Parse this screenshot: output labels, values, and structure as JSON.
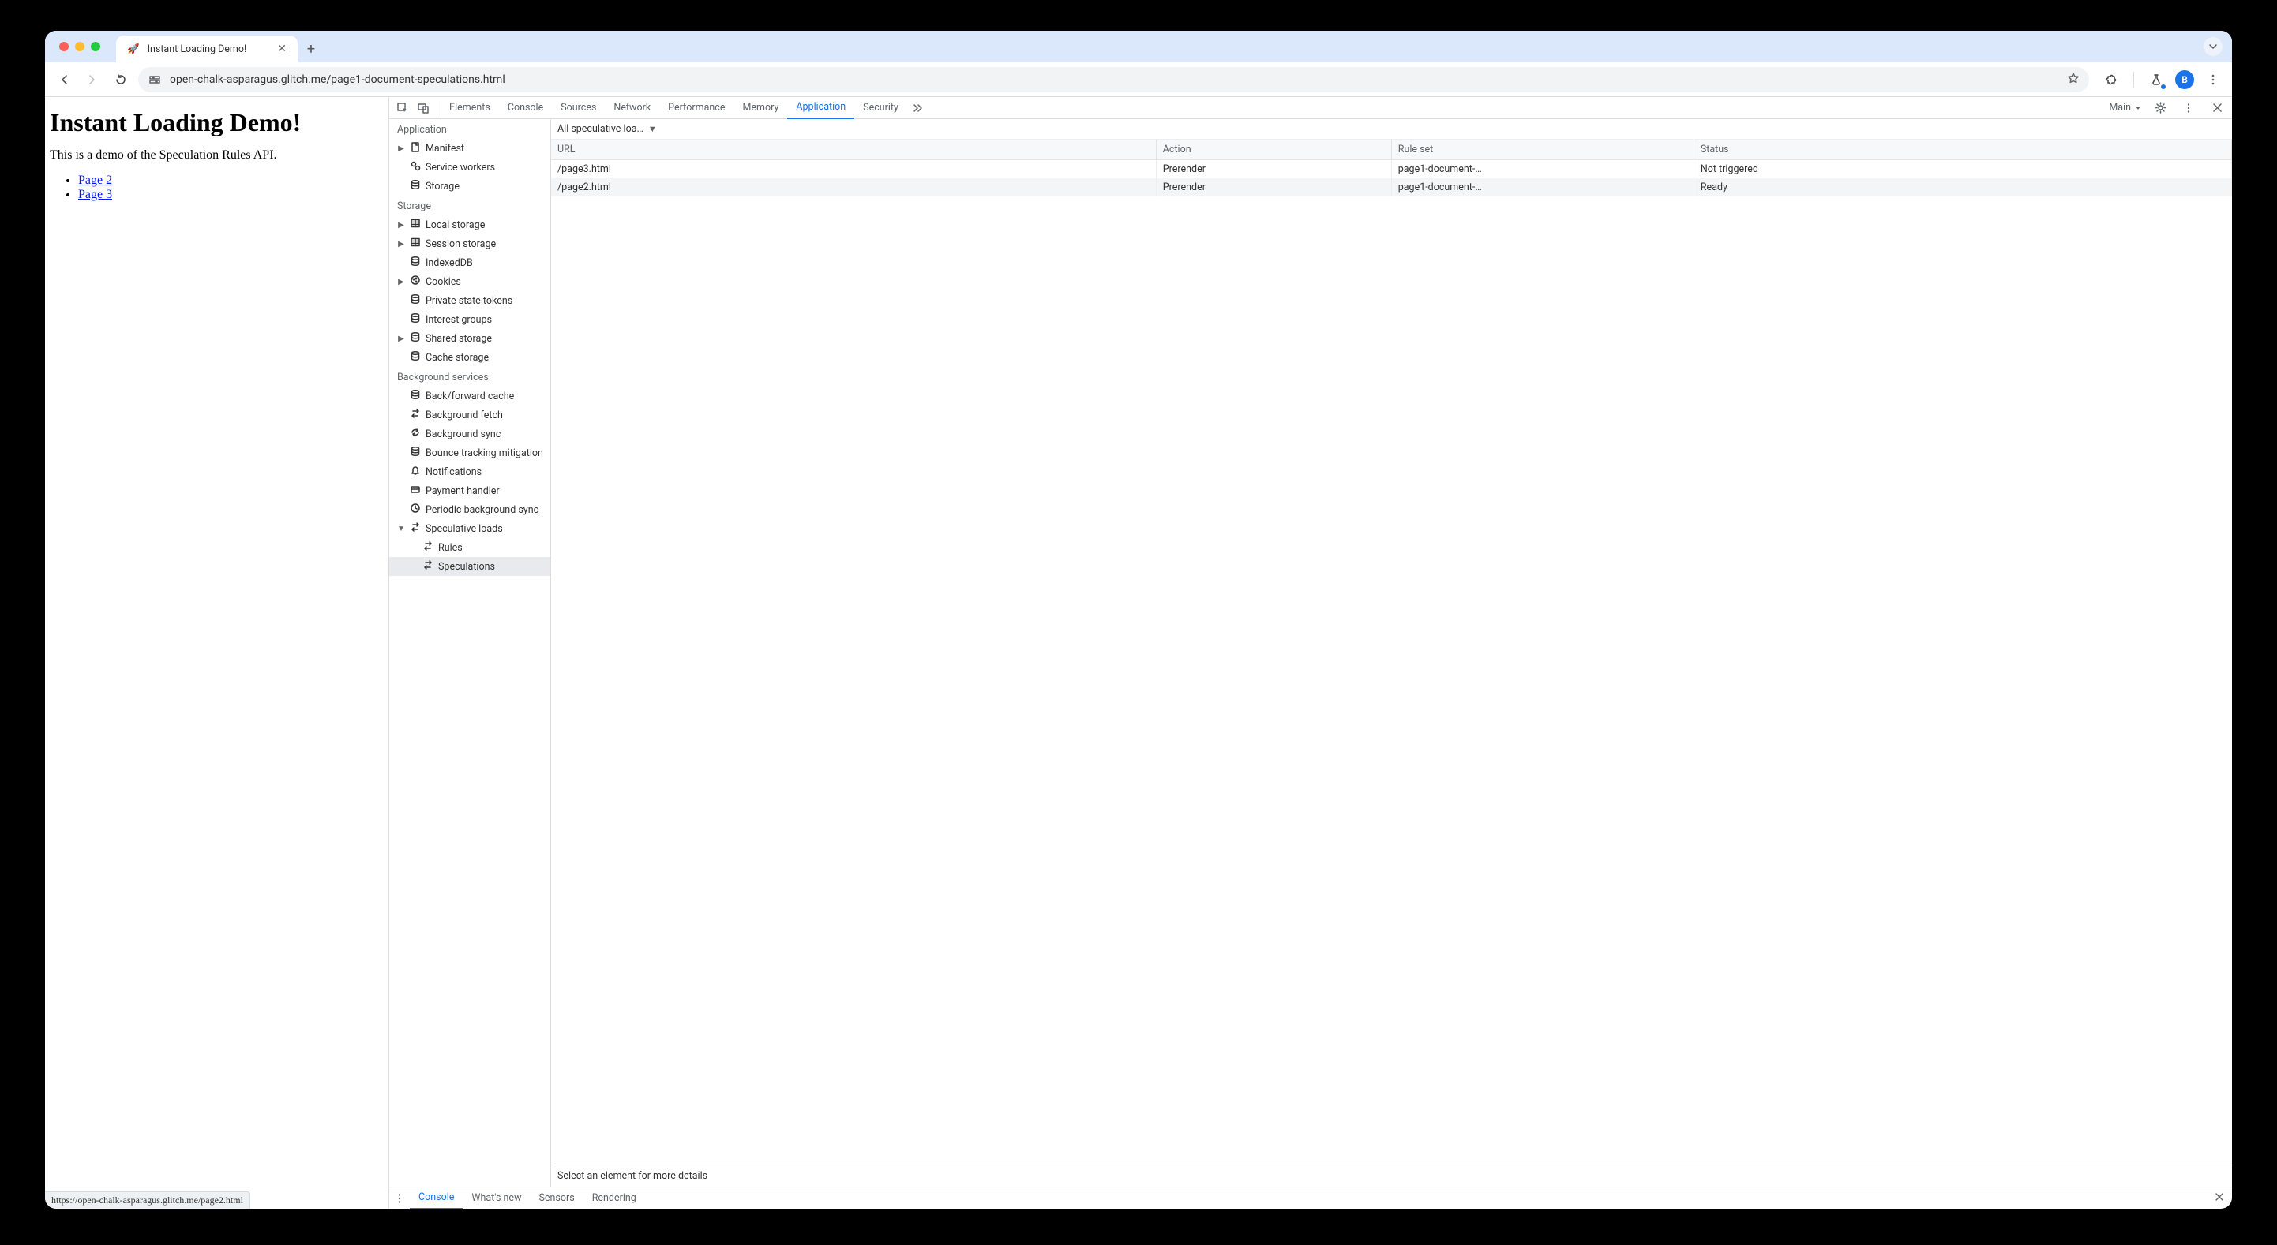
{
  "browser": {
    "tab_title": "Instant Loading Demo!",
    "url": "open-chalk-asparagus.glitch.me/page1-document-speculations.html",
    "avatar_letter": "B",
    "status_hover": "https://open-chalk-asparagus.glitch.me/page2.html"
  },
  "page": {
    "heading": "Instant Loading Demo!",
    "intro": "This is a demo of the Speculation Rules API.",
    "links": [
      "Page 2",
      "Page 3"
    ]
  },
  "devtools": {
    "tabs": [
      "Elements",
      "Console",
      "Sources",
      "Network",
      "Performance",
      "Memory",
      "Application",
      "Security"
    ],
    "active_tab": "Application",
    "target_label": "Main",
    "sidebar": {
      "groups": [
        {
          "title": "Application",
          "items": [
            {
              "label": "Manifest",
              "icon": "file",
              "expandable": true
            },
            {
              "label": "Service workers",
              "icon": "gears"
            },
            {
              "label": "Storage",
              "icon": "db"
            }
          ]
        },
        {
          "title": "Storage",
          "items": [
            {
              "label": "Local storage",
              "icon": "grid",
              "expandable": true
            },
            {
              "label": "Session storage",
              "icon": "grid",
              "expandable": true
            },
            {
              "label": "IndexedDB",
              "icon": "db"
            },
            {
              "label": "Cookies",
              "icon": "cookie",
              "expandable": true
            },
            {
              "label": "Private state tokens",
              "icon": "db"
            },
            {
              "label": "Interest groups",
              "icon": "db"
            },
            {
              "label": "Shared storage",
              "icon": "db",
              "expandable": true
            },
            {
              "label": "Cache storage",
              "icon": "db"
            }
          ]
        },
        {
          "title": "Background services",
          "items": [
            {
              "label": "Back/forward cache",
              "icon": "db"
            },
            {
              "label": "Background fetch",
              "icon": "swap"
            },
            {
              "label": "Background sync",
              "icon": "sync"
            },
            {
              "label": "Bounce tracking mitigation",
              "icon": "db"
            },
            {
              "label": "Notifications",
              "icon": "bell"
            },
            {
              "label": "Payment handler",
              "icon": "card"
            },
            {
              "label": "Periodic background sync",
              "icon": "clock"
            },
            {
              "label": "Speculative loads",
              "icon": "swap",
              "expandable": true,
              "expanded": true,
              "children": [
                {
                  "label": "Rules",
                  "icon": "swap"
                },
                {
                  "label": "Speculations",
                  "icon": "swap",
                  "selected": true
                }
              ]
            }
          ]
        }
      ]
    },
    "filter_label": "All speculative loa…",
    "table": {
      "columns": [
        "URL",
        "Action",
        "Rule set",
        "Status"
      ],
      "rows": [
        {
          "url": "/page3.html",
          "action": "Prerender",
          "ruleset": "page1-document-…",
          "status": "Not triggered"
        },
        {
          "url": "/page2.html",
          "action": "Prerender",
          "ruleset": "page1-document-…",
          "status": "Ready"
        }
      ]
    },
    "details_hint": "Select an element for more details",
    "drawer_tabs": [
      "Console",
      "What's new",
      "Sensors",
      "Rendering"
    ],
    "drawer_active": "Console"
  }
}
